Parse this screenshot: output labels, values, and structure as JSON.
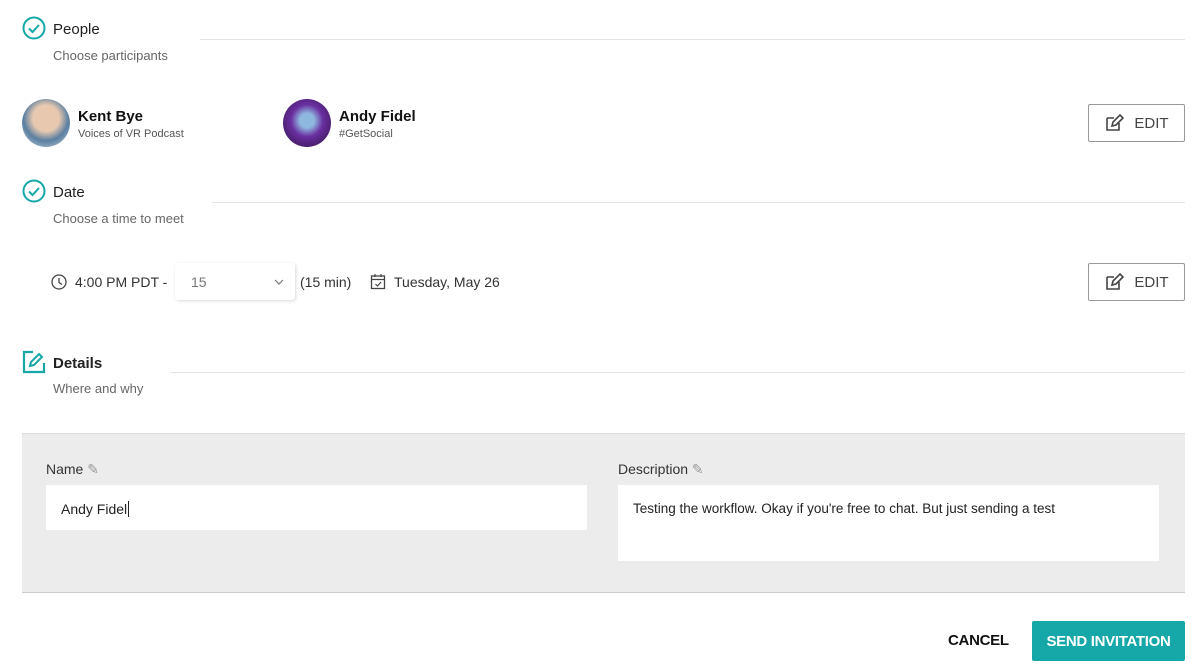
{
  "people": {
    "title": "People",
    "subtitle": "Choose participants",
    "edit_label": "EDIT",
    "participants": [
      {
        "name": "Kent Bye",
        "org": "Voices of VR Podcast"
      },
      {
        "name": "Andy Fidel",
        "org": "#GetSocial"
      }
    ]
  },
  "date": {
    "title": "Date",
    "subtitle": "Choose a time to meet",
    "time": "4:00 PM PDT -",
    "duration_value": "15",
    "duration_text": "(15 min)",
    "day": "Tuesday, May 26",
    "edit_label": "EDIT"
  },
  "details": {
    "title": "Details",
    "subtitle": "Where and why",
    "name_label": "Name",
    "name_value": "Andy Fidel",
    "description_label": "Description",
    "description_value": "Testing the workflow. Okay if you're free to chat. But just sending a test"
  },
  "actions": {
    "cancel": "CANCEL",
    "send": "SEND INVITATION"
  },
  "colors": {
    "accent": "#16a7a8"
  }
}
